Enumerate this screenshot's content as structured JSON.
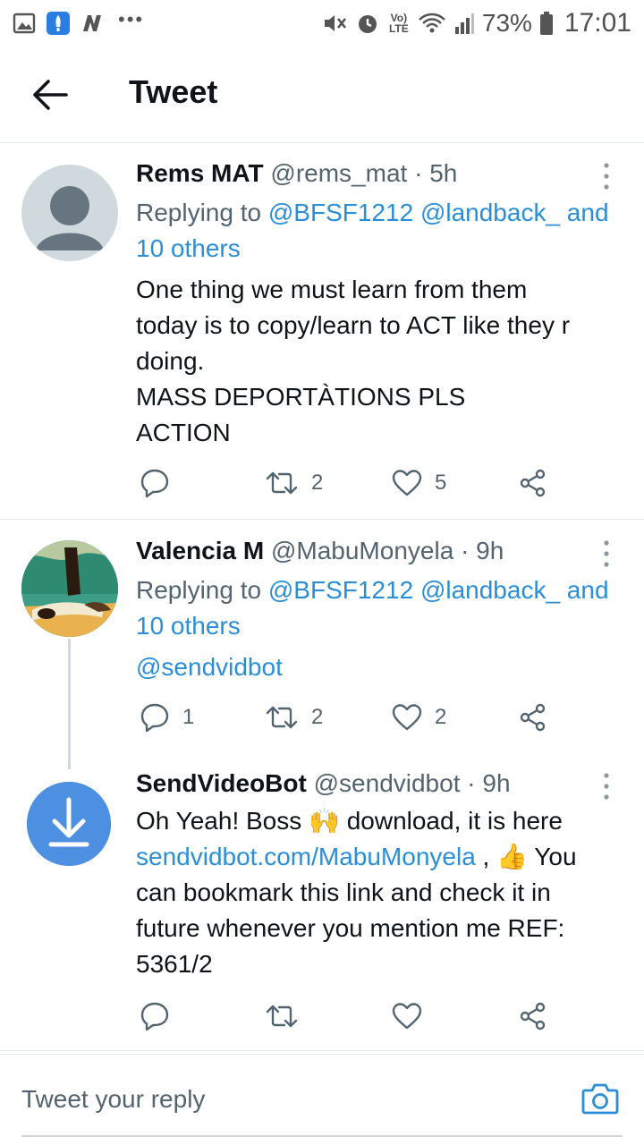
{
  "status_bar": {
    "battery": "73%",
    "time": "17:01",
    "network": "Vo) LTE"
  },
  "header": {
    "title": "Tweet"
  },
  "tweets": [
    {
      "name": "Rems MAT",
      "handle": "@rems_mat",
      "time": "5h",
      "replying_prefix": "Replying to",
      "reply_user1": "@BFSF1212",
      "reply_user2": "@landback_",
      "reply_and": "and",
      "reply_others": "10 others",
      "text_lines": [
        "One thing we must learn from them",
        "today is to copy/learn to ACT like they r",
        "doing.",
        "MASS DEPORTÀTIONS PLS",
        "ACTION"
      ],
      "retweets": "2",
      "likes": "5"
    },
    {
      "name": "Valencia M",
      "handle": "@MabuMonyela",
      "time": "9h",
      "replying_prefix": "Replying to",
      "reply_user1": "@BFSF1212",
      "reply_user2": "@landback_",
      "reply_and": "and",
      "reply_others": "10 others",
      "mention": "@sendvidbot",
      "replies": "1",
      "retweets": "2",
      "likes": "2"
    },
    {
      "name": "SendVideoBot",
      "handle": "@sendvidbot",
      "time": "9h",
      "line1": "Oh Yeah! Boss",
      "line1_emoji": "🙌",
      "line1_rest": "download, it is here",
      "link": "sendvidbot.com/MabuMonyela",
      "line2_mid": ",",
      "line2_emoji": "👍",
      "line2_rest": "You",
      "text_lines": [
        "can bookmark this link and check it in",
        "future whenever you mention me REF:",
        "5361/2"
      ]
    }
  ],
  "reply_bar": {
    "placeholder": "Tweet your reply"
  },
  "colors": {
    "link": "#2b8ed6",
    "text": "#0f1419",
    "secondary": "#536471",
    "divider": "#e1e8ed"
  }
}
